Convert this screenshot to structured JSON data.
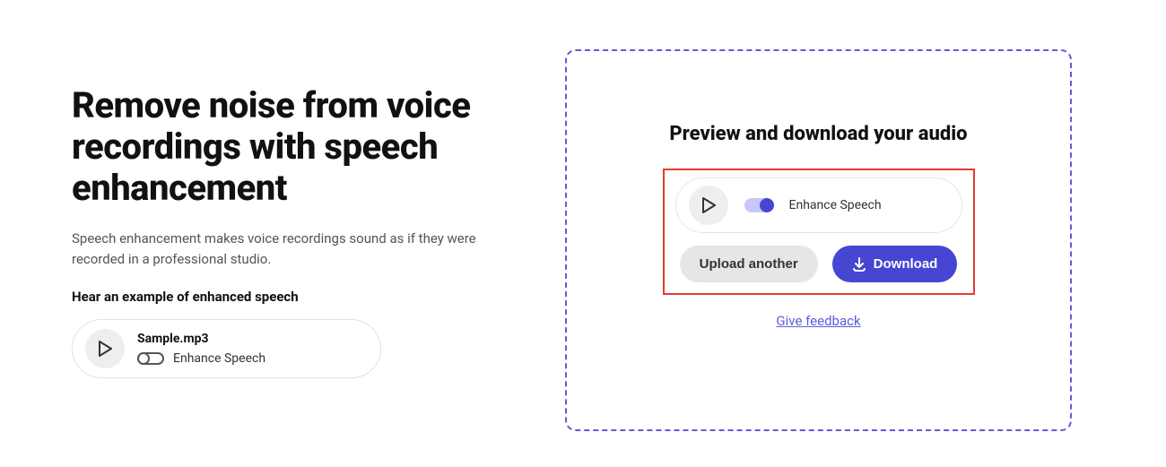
{
  "left": {
    "title": "Remove noise from voice recordings with speech enhancement",
    "description": "Speech enhancement makes voice recordings sound as if they were recorded in a professional studio.",
    "example_heading": "Hear an example of enhanced speech",
    "sample": {
      "filename": "Sample.mp3",
      "toggle_label": "Enhance Speech"
    }
  },
  "right": {
    "title": "Preview and download your audio",
    "toggle_label": "Enhance Speech",
    "upload_label": "Upload another",
    "download_label": "Download",
    "feedback_label": "Give feedback"
  }
}
